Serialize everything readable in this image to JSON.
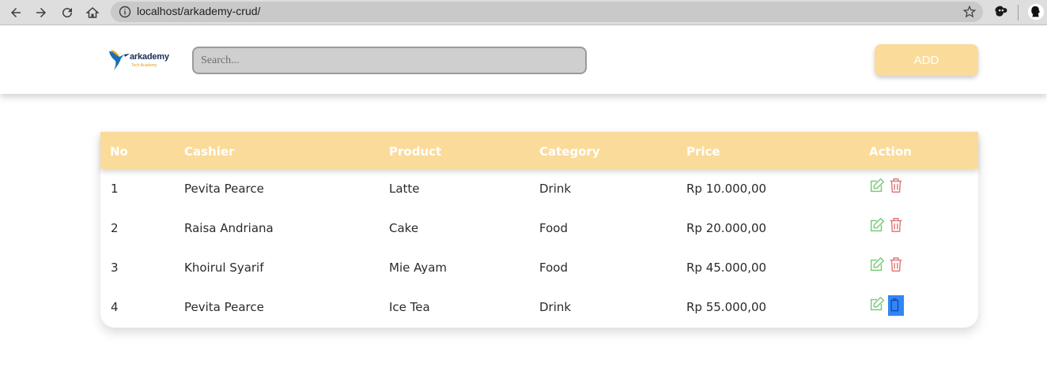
{
  "browser": {
    "url": "localhost/arkademy-crud/"
  },
  "header": {
    "logo_text": "arkademy",
    "logo_sub": "Tech Academy",
    "search_placeholder": "Search...",
    "add_label": "ADD"
  },
  "table": {
    "columns": [
      "No",
      "Cashier",
      "Product",
      "Category",
      "Price",
      "Action"
    ],
    "rows": [
      {
        "no": "1",
        "cashier": "Pevita Pearce",
        "product": "Latte",
        "category": "Drink",
        "price": "Rp 10.000,00"
      },
      {
        "no": "2",
        "cashier": "Raisa Andriana",
        "product": "Cake",
        "category": "Food",
        "price": "Rp 20.000,00"
      },
      {
        "no": "3",
        "cashier": "Khoirul Syarif",
        "product": "Mie Ayam",
        "category": "Food",
        "price": "Rp 45.000,00"
      },
      {
        "no": "4",
        "cashier": "Pevita Pearce",
        "product": "Ice Tea",
        "category": "Drink",
        "price": "Rp 55.000,00"
      }
    ]
  },
  "colors": {
    "accent": "#fadb9a",
    "edit_icon": "#7cc97c",
    "delete_icon": "#e07a7a",
    "selection": "#2f86f6"
  }
}
